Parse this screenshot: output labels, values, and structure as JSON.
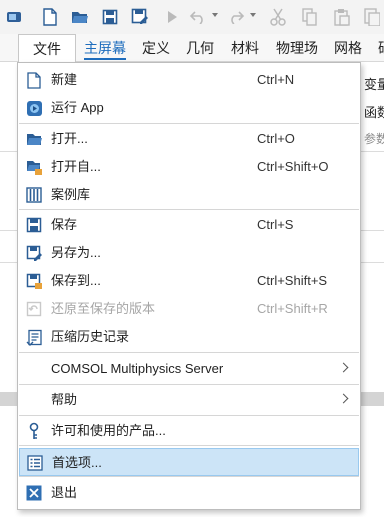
{
  "toolbar": {
    "icons": [
      "app-icon",
      "new-file-icon",
      "open-folder-icon",
      "save-icon",
      "save-as-icon",
      "run-icon",
      "undo-icon",
      "redo-icon",
      "cut-icon",
      "copy-icon",
      "paste-icon",
      "duplicate-icon"
    ]
  },
  "tabs": [
    {
      "label": "文件",
      "active": false
    },
    {
      "label": "主屏幕",
      "active": true
    },
    {
      "label": "定义",
      "active": false
    },
    {
      "label": "几何",
      "active": false
    },
    {
      "label": "材料",
      "active": false
    },
    {
      "label": "物理场",
      "active": false
    },
    {
      "label": "网格",
      "active": false
    },
    {
      "label": "研",
      "active": false
    }
  ],
  "background": {
    "var_label": "变量",
    "func_label": "函数",
    "param_label": "参数"
  },
  "menu": {
    "items": [
      {
        "label": "新建",
        "shortcut": "Ctrl+N",
        "icon": "new-document-icon"
      },
      {
        "label": "运行 App",
        "shortcut": "",
        "icon": "run-app-icon"
      },
      {
        "label": "打开...",
        "shortcut": "Ctrl+O",
        "icon": "open-folder-icon"
      },
      {
        "label": "打开自...",
        "shortcut": "Ctrl+Shift+O",
        "icon": "open-from-icon"
      },
      {
        "label": "案例库",
        "shortcut": "",
        "icon": "application-library-icon"
      },
      {
        "label": "保存",
        "shortcut": "Ctrl+S",
        "icon": "save-icon"
      },
      {
        "label": "另存为...",
        "shortcut": "",
        "icon": "save-as-icon"
      },
      {
        "label": "保存到...",
        "shortcut": "Ctrl+Shift+S",
        "icon": "save-to-icon"
      },
      {
        "label": "还原至保存的版本",
        "shortcut": "Ctrl+Shift+R",
        "icon": "revert-icon",
        "disabled": true
      },
      {
        "label": "压缩历史记录",
        "shortcut": "",
        "icon": "compact-history-icon"
      },
      {
        "label": "COMSOL Multiphysics Server",
        "shortcut": "",
        "icon": "",
        "submenu": true
      },
      {
        "label": "帮助",
        "shortcut": "",
        "icon": "",
        "submenu": true
      },
      {
        "label": "许可和使用的产品...",
        "shortcut": "",
        "icon": "license-key-icon"
      },
      {
        "label": "首选项...",
        "shortcut": "",
        "icon": "preferences-icon",
        "highlighted": true
      },
      {
        "label": "退出",
        "shortcut": "",
        "icon": "exit-icon"
      }
    ]
  },
  "colors": {
    "accent": "#1e6dbd",
    "highlight": "#cce4f7",
    "highlight_border": "#99c9ef",
    "disabled_text": "#a6a6a6"
  }
}
